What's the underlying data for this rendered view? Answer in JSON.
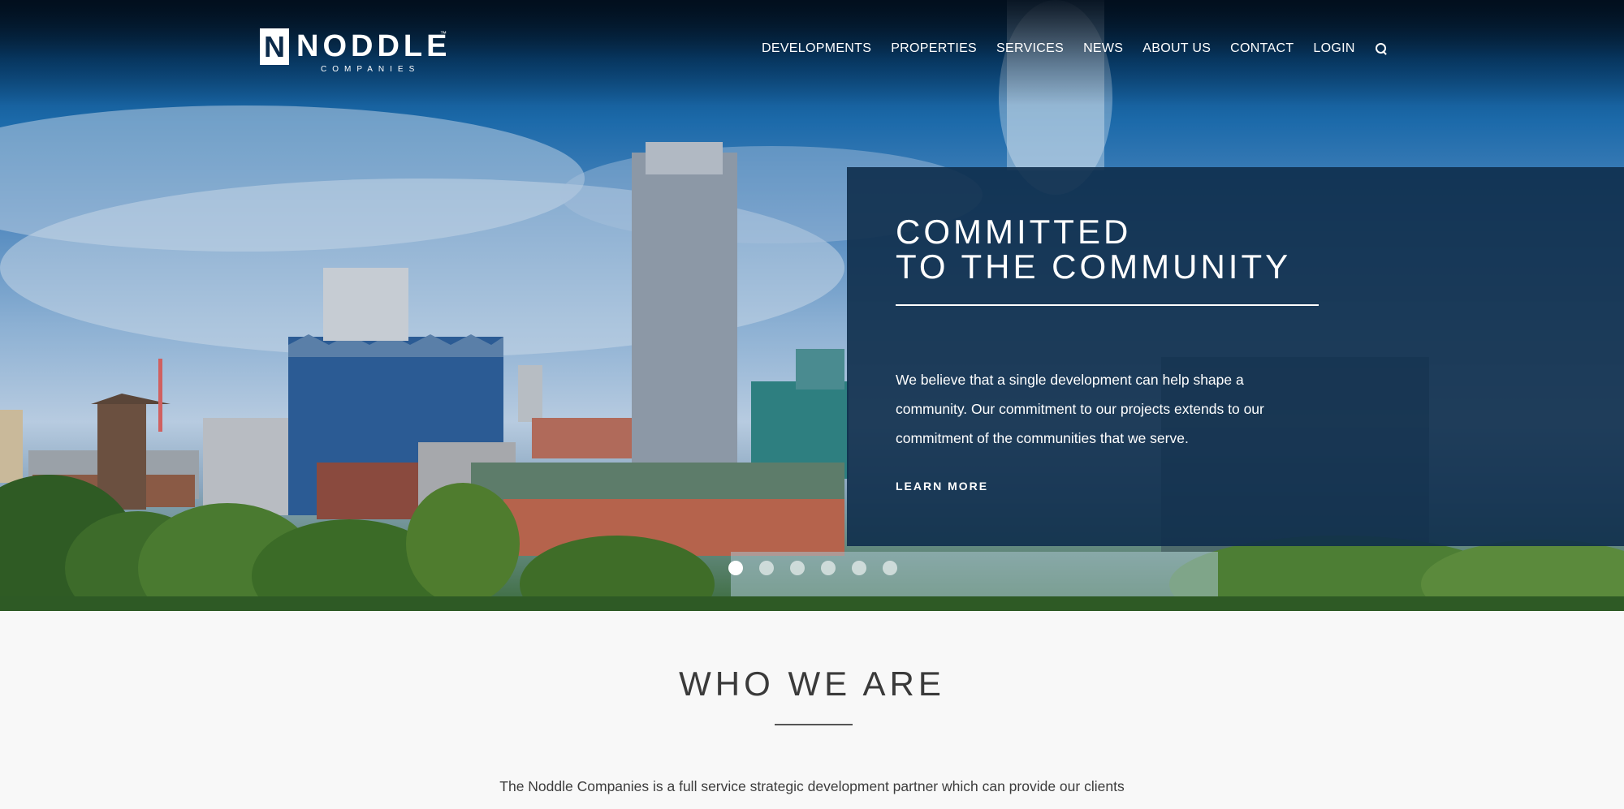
{
  "header": {
    "logo": {
      "mark": "N",
      "name": "NODDLE",
      "tm": "™",
      "sub": "COMPANIES"
    },
    "nav": [
      {
        "label": "DEVELOPMENTS"
      },
      {
        "label": "PROPERTIES"
      },
      {
        "label": "SERVICES"
      },
      {
        "label": "NEWS"
      },
      {
        "label": "ABOUT US"
      },
      {
        "label": "CONTACT"
      },
      {
        "label": "LOGIN"
      }
    ],
    "search_icon": "search-icon"
  },
  "hero": {
    "title_line1": "COMMITTED",
    "title_line2": "TO THE COMMUNITY",
    "body_lines": [
      "We believe that a single development can help shape a",
      "community.  Our commitment to our projects extends to our",
      "commitment of the communities that we serve."
    ],
    "link": "LEARN MORE",
    "slides": {
      "count": 6,
      "active": 1
    }
  },
  "who": {
    "title": "WHO WE ARE",
    "text": "The Noddle Companies is a full service strategic development partner which can provide our clients"
  },
  "colors": {
    "panel": "#0e2d4b",
    "sky": "#1c6aaa",
    "text_dark": "#3a3a3a"
  }
}
